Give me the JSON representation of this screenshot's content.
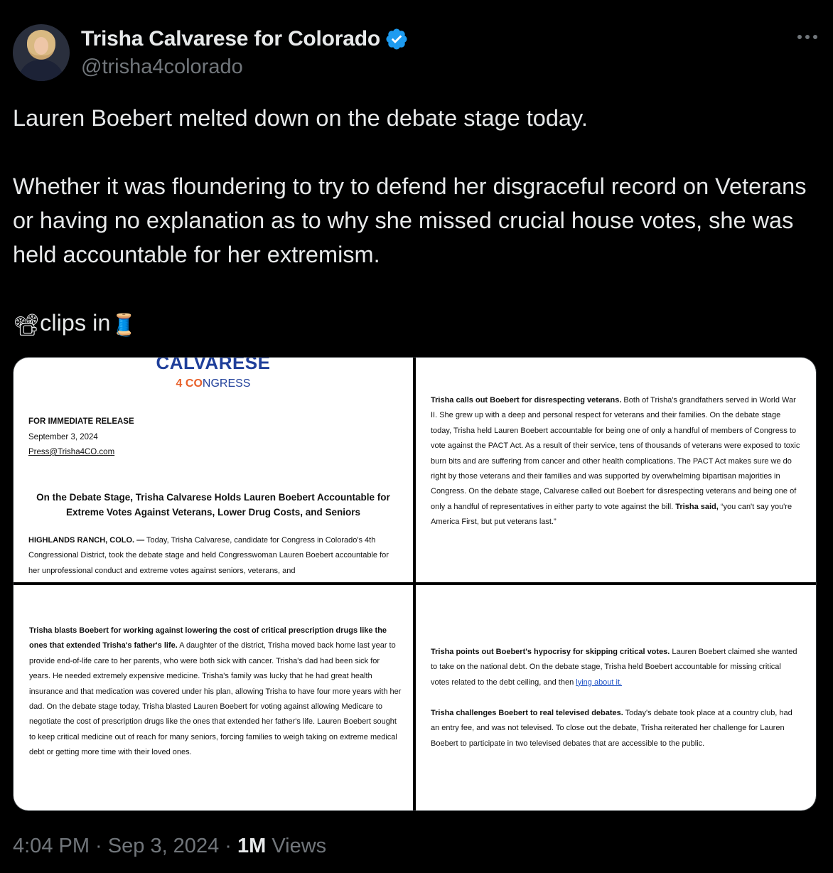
{
  "author": {
    "name": "Trisha Calvarese for Colorado",
    "handle": "@trisha4colorado",
    "verified": true,
    "avatar_icon": "profile-photo"
  },
  "tweet": {
    "text": "Lauren Boebert melted down on the debate stage today.\n\nWhether it was floundering to try to defend her disgraceful record on Veterans or having no explanation as to why she missed crucial house votes, she was held accountable for her extremism.\n\n",
    "clips_label": "clips in",
    "emoji_1": "📽",
    "emoji_2": "🧵"
  },
  "media": {
    "tile1": {
      "logo_top": "CALVARESE",
      "logo_num": "4",
      "logo_co": "CO",
      "logo_rest": "NGRESS",
      "release": "FOR IMMEDIATE RELEASE",
      "date": "September 3, 2024",
      "email": "Press@Trisha4CO.com",
      "headline": "On the Debate Stage, Trisha Calvarese Holds Lauren Boebert Accountable for Extreme Votes Against Veterans, Lower Drug Costs, and Seniors",
      "dateline": "HIGHLANDS RANCH, COLO. —",
      "body": " Today, Trisha Calvarese, candidate for Congress in Colorado's 4th Congressional District, took the debate stage and held Congresswoman Lauren Boebert accountable for her unprofessional conduct and extreme votes against seniors, veterans, and"
    },
    "tile2": {
      "lead": "Trisha calls out Boebert for disrespecting veterans.",
      "body": " Both of Trisha's grandfathers served in World War II. She grew up with a deep and personal respect for veterans and their families. On the debate stage today, Trisha held Lauren Boebert accountable for being one of only a handful of members of Congress to vote against the PACT Act. As a result of their service, tens of thousands of veterans were exposed to toxic burn bits and are suffering from cancer and other health complications. The PACT Act makes sure we do right by those veterans and their families and was supported by overwhelming bipartisan majorities in Congress. On the debate stage, Calvarese called out Boebert for disrespecting veterans and being one of only a handful of representatives in either party to vote against the bill.",
      "said_label": "Trisha said,",
      "quote": " “you can't say you're America First, but put veterans last.”"
    },
    "tile3": {
      "lead": "Trisha blasts Boebert for working against lowering the cost of critical prescription drugs like the ones that extended Trisha's father's life.",
      "body": " A daughter of the district, Trisha moved back home last year to provide end-of-life care to her parents, who were both sick with cancer. Trisha's dad had been sick for years. He needed extremely expensive medicine. Trisha's family was lucky that he had great health insurance and that medication was covered under his plan, allowing Trisha to have four more years with her dad. On the debate stage today, Trisha blasted Lauren Boebert for voting against allowing Medicare to negotiate the cost of prescription drugs like the ones that extended her father's life. Lauren Boebert sought to keep critical medicine out of reach for many seniors, forcing families to weigh taking on extreme medical debt or getting more time with their loved ones."
    },
    "tile4": {
      "lead1": "Trisha points out Boebert's hypocrisy for skipping critical votes.",
      "body1": " Lauren Boebert claimed she wanted to take on the national debt. On the debate stage, Trisha held Boebert accountable for missing critical votes related to the debt ceiling, and then ",
      "link": "lying about it.",
      "lead2": "Trisha challenges Boebert to real televised debates.",
      "body2": " Today's debate took place at a country club, had an entry fee, and was not televised. To close out the debate, Trisha reiterated her challenge for Lauren Boebert to participate in two televised debates that are accessible to the public."
    }
  },
  "meta": {
    "time": "4:04 PM",
    "sep": " · ",
    "date": "Sep 3, 2024",
    "views_num": "1M",
    "views_label": " Views"
  },
  "colors": {
    "background": "#000000",
    "text": "#e7e9ea",
    "secondary": "#71767b",
    "verified": "#1d9bf0",
    "link": "#1a4fc4"
  }
}
